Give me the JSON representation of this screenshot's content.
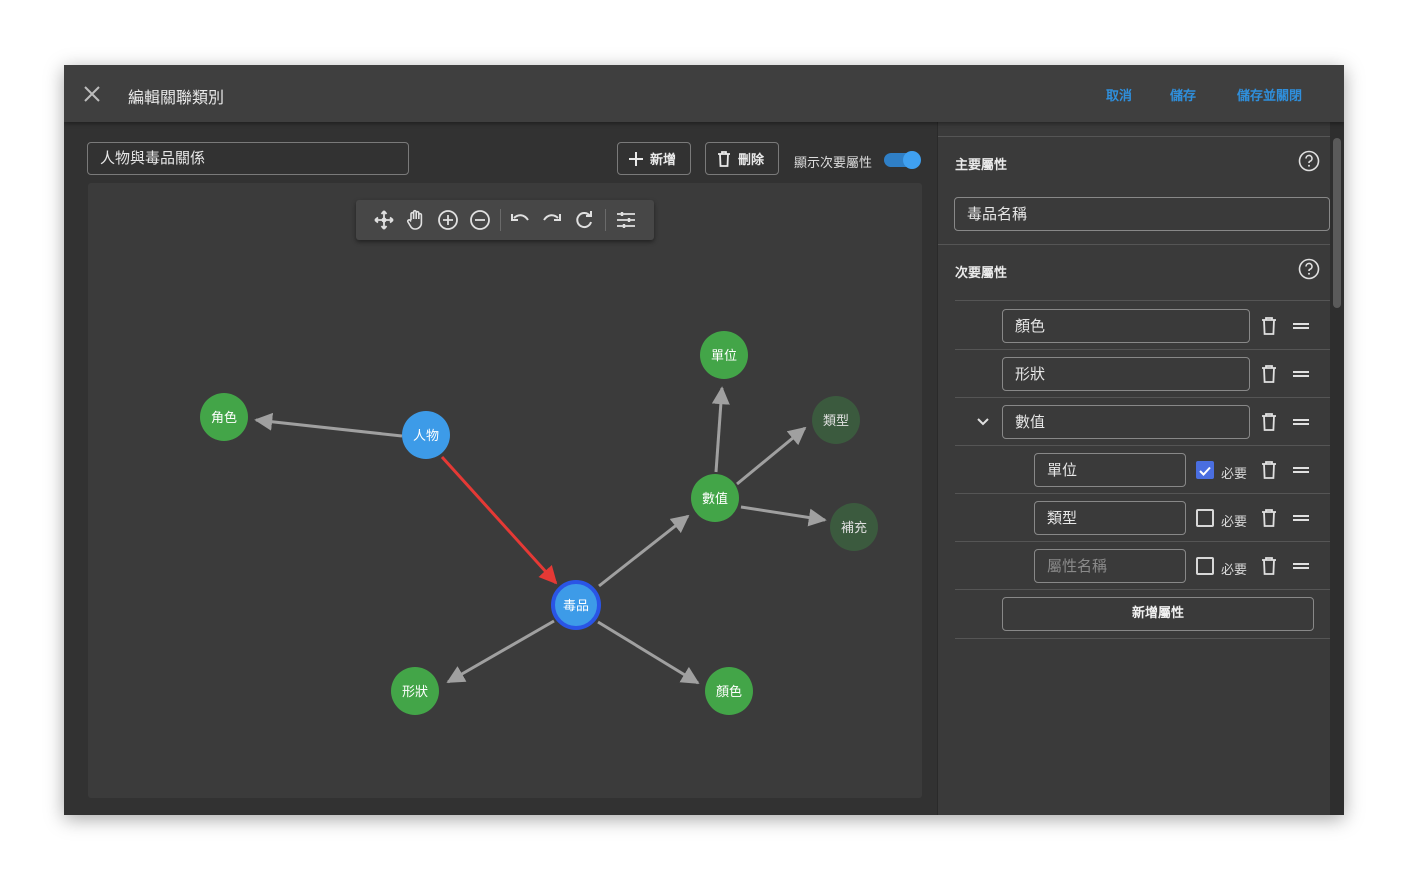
{
  "dialog": {
    "title": "編輯關聯類別",
    "actions": {
      "cancel": "取消",
      "save": "儲存",
      "save_close": "儲存並關閉"
    },
    "accent_color": "#2f8fdc"
  },
  "left": {
    "name_value": "人物與毒品關係",
    "add_button": "新增",
    "delete_button": "刪除",
    "toggle_label": "顯示次要屬性",
    "toggle_on": true,
    "toolbar_icons": [
      "move-icon",
      "pan-hand-icon",
      "zoom-in-icon",
      "zoom-out-icon",
      "undo-icon",
      "redo-icon",
      "refresh-icon",
      "settings-icon"
    ]
  },
  "graph": {
    "nodes": {
      "person": "人物",
      "role": "角色",
      "drug": "毒品",
      "shape": "形狀",
      "color": "顏色",
      "value": "數值",
      "unit": "單位",
      "type": "類型",
      "extra": "補充"
    },
    "colors": {
      "primary_node": "#3d9be8",
      "attribute_node": "#43a548",
      "dim_node": "#3b5a3e",
      "edge": "#a0a0a0",
      "highlight_edge": "#e53935"
    }
  },
  "right": {
    "primary_section": "主要屬性",
    "primary_value": "毒品名稱",
    "secondary_section": "次要屬性",
    "attrs": [
      {
        "value": "顏色"
      },
      {
        "value": "形狀"
      },
      {
        "value": "數值"
      }
    ],
    "sub_attrs": [
      {
        "value": "單位",
        "required_label": "必要",
        "required": true
      },
      {
        "value": "類型",
        "required_label": "必要",
        "required": false
      },
      {
        "placeholder": "屬性名稱",
        "required_label": "必要",
        "required": false
      }
    ],
    "add_attr_button": "新增屬性"
  }
}
